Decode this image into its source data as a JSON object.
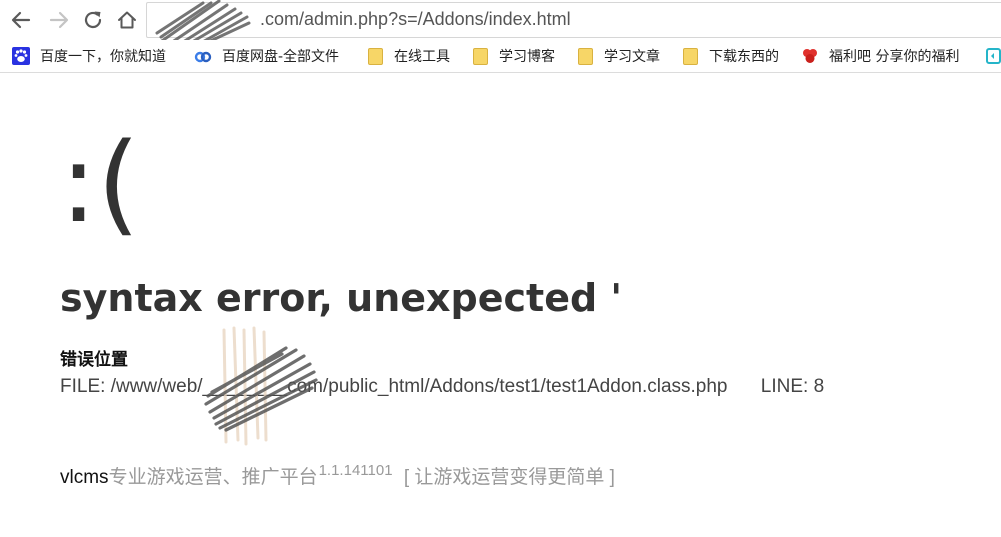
{
  "browser": {
    "url_visible": ".com/admin.php?s=/Addons/index.html",
    "bookmarks": [
      {
        "label": "百度一下，你就知道",
        "icon": "baidu-paw-icon"
      },
      {
        "label": "百度网盘-全部文件",
        "icon": "baidu-pan-icon"
      },
      {
        "label": "在线工具",
        "icon": "folder-icon"
      },
      {
        "label": "学习博客",
        "icon": "folder-icon"
      },
      {
        "label": "学习文章",
        "icon": "folder-icon"
      },
      {
        "label": "下载东西的",
        "icon": "folder-icon"
      },
      {
        "label": "福利吧 分享你的福利",
        "icon": "fuliba-icon"
      }
    ]
  },
  "error": {
    "face": ":(",
    "message": "syntax error, unexpected '",
    "location_label": "错误位置",
    "file_label": "FILE:",
    "file_path": "/www/web/________com/public_html/Addons/test1/test1Addon.class.php",
    "line_label": "LINE:",
    "line_no": "8"
  },
  "footer": {
    "brand": "vlcms",
    "tagline": "专业游戏运营、推广平台",
    "version": "1.1.141101",
    "slogan": "[ 让游戏运营变得更简单 ]"
  },
  "colors": {
    "text_dark": "#333333",
    "text_muted": "#999999",
    "folder": "#f7d667",
    "baidu_blue": "#2932e1",
    "fuliba_red": "#e0312d"
  }
}
